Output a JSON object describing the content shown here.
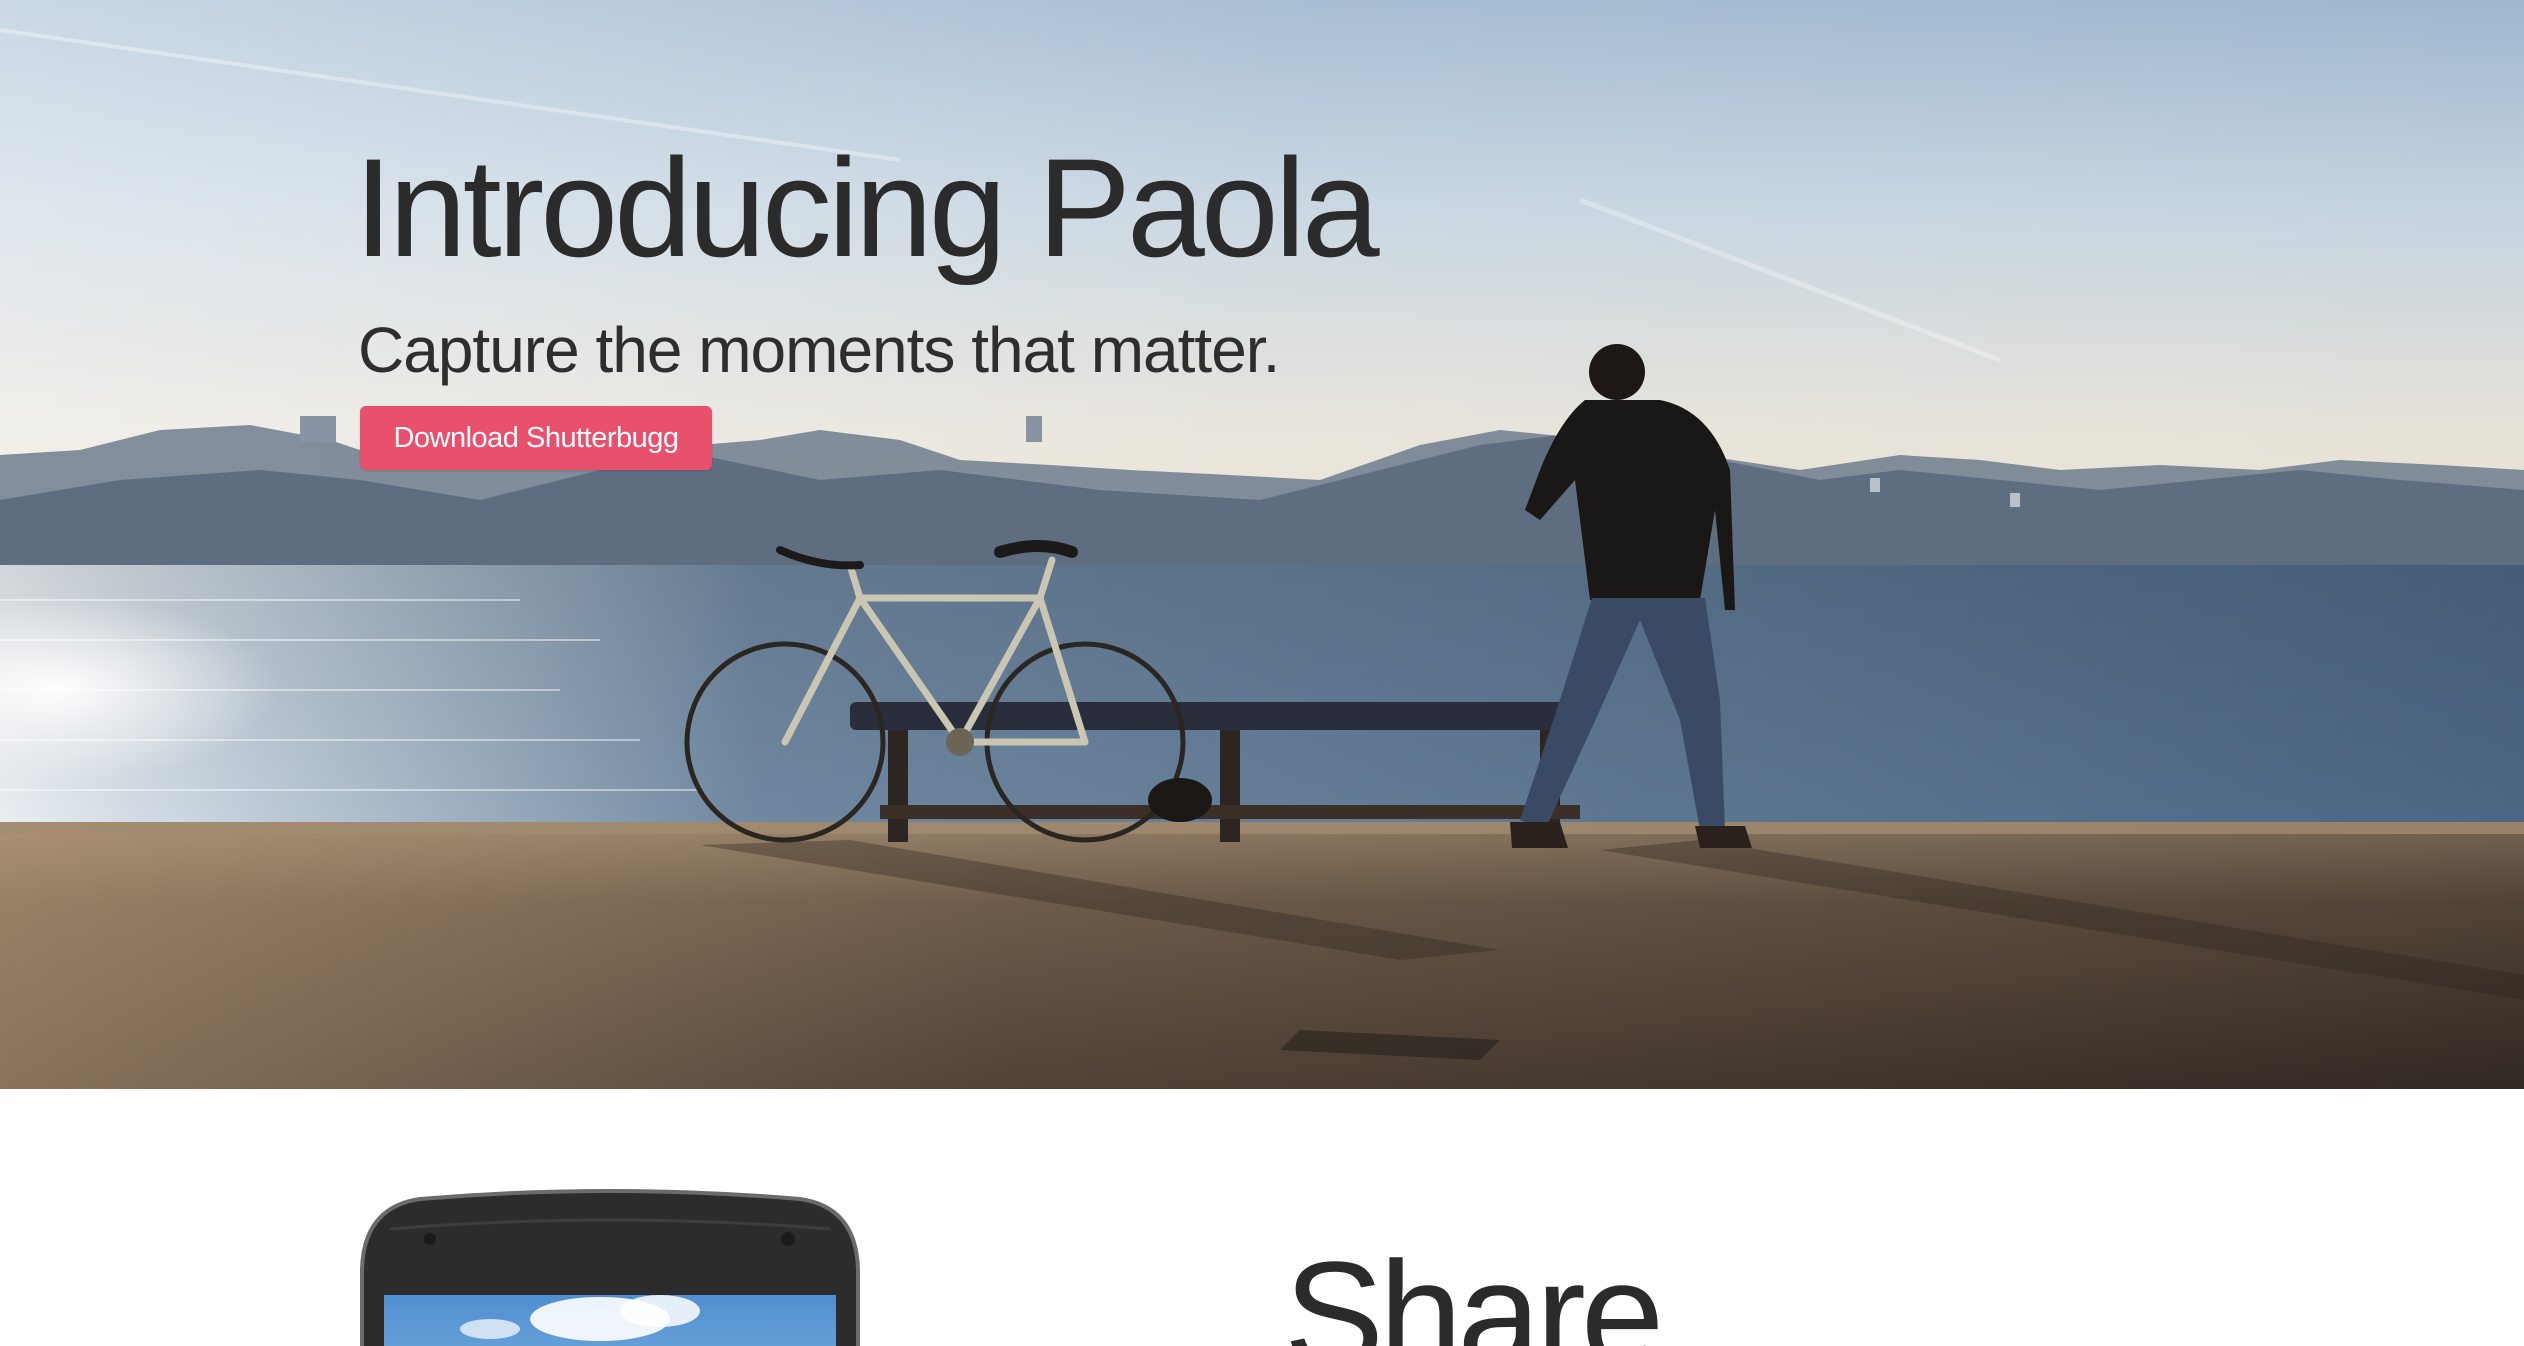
{
  "hero": {
    "title": "Introducing Paola",
    "subtitle": "Capture the moments that matter.",
    "cta_label": "Download Shutterbugg",
    "image_description_icon": "photo-lakeside-bicycle",
    "colors": {
      "cta_background": "#e8506c",
      "cta_text": "#ffffff",
      "heading_text": "#2b2b2b"
    }
  },
  "feature": {
    "heading": "Share",
    "phone_icon": "smartphone-icon"
  }
}
